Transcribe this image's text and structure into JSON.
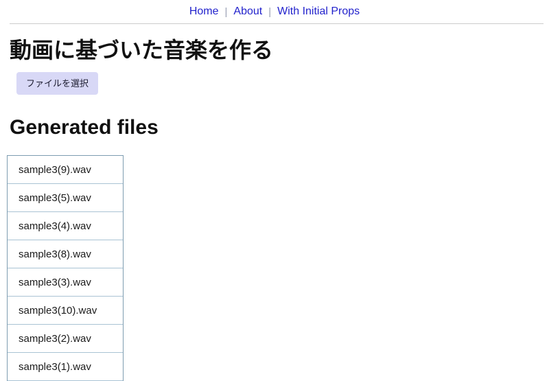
{
  "header": {
    "nav": {
      "items": [
        {
          "label": "Home"
        },
        {
          "label": "About"
        },
        {
          "label": "With Initial Props"
        }
      ],
      "separator": "|"
    }
  },
  "main": {
    "page_title": "動画に基づいた音楽を作る",
    "file_select_button": "ファイルを選択",
    "generated_files": {
      "heading": "Generated files",
      "items": [
        {
          "name": "sample3(9).wav"
        },
        {
          "name": "sample3(5).wav"
        },
        {
          "name": "sample3(4).wav"
        },
        {
          "name": "sample3(8).wav"
        },
        {
          "name": "sample3(3).wav"
        },
        {
          "name": "sample3(10).wav"
        },
        {
          "name": "sample3(2).wav"
        },
        {
          "name": "sample3(1).wav"
        }
      ]
    }
  },
  "colors": {
    "link": "#2222cc",
    "button_background": "#d8d8f6",
    "list_border": "#7d9cb0",
    "list_divider": "#a9c3d4",
    "header_rule": "#cccccc",
    "page_background": "#ffffff"
  }
}
